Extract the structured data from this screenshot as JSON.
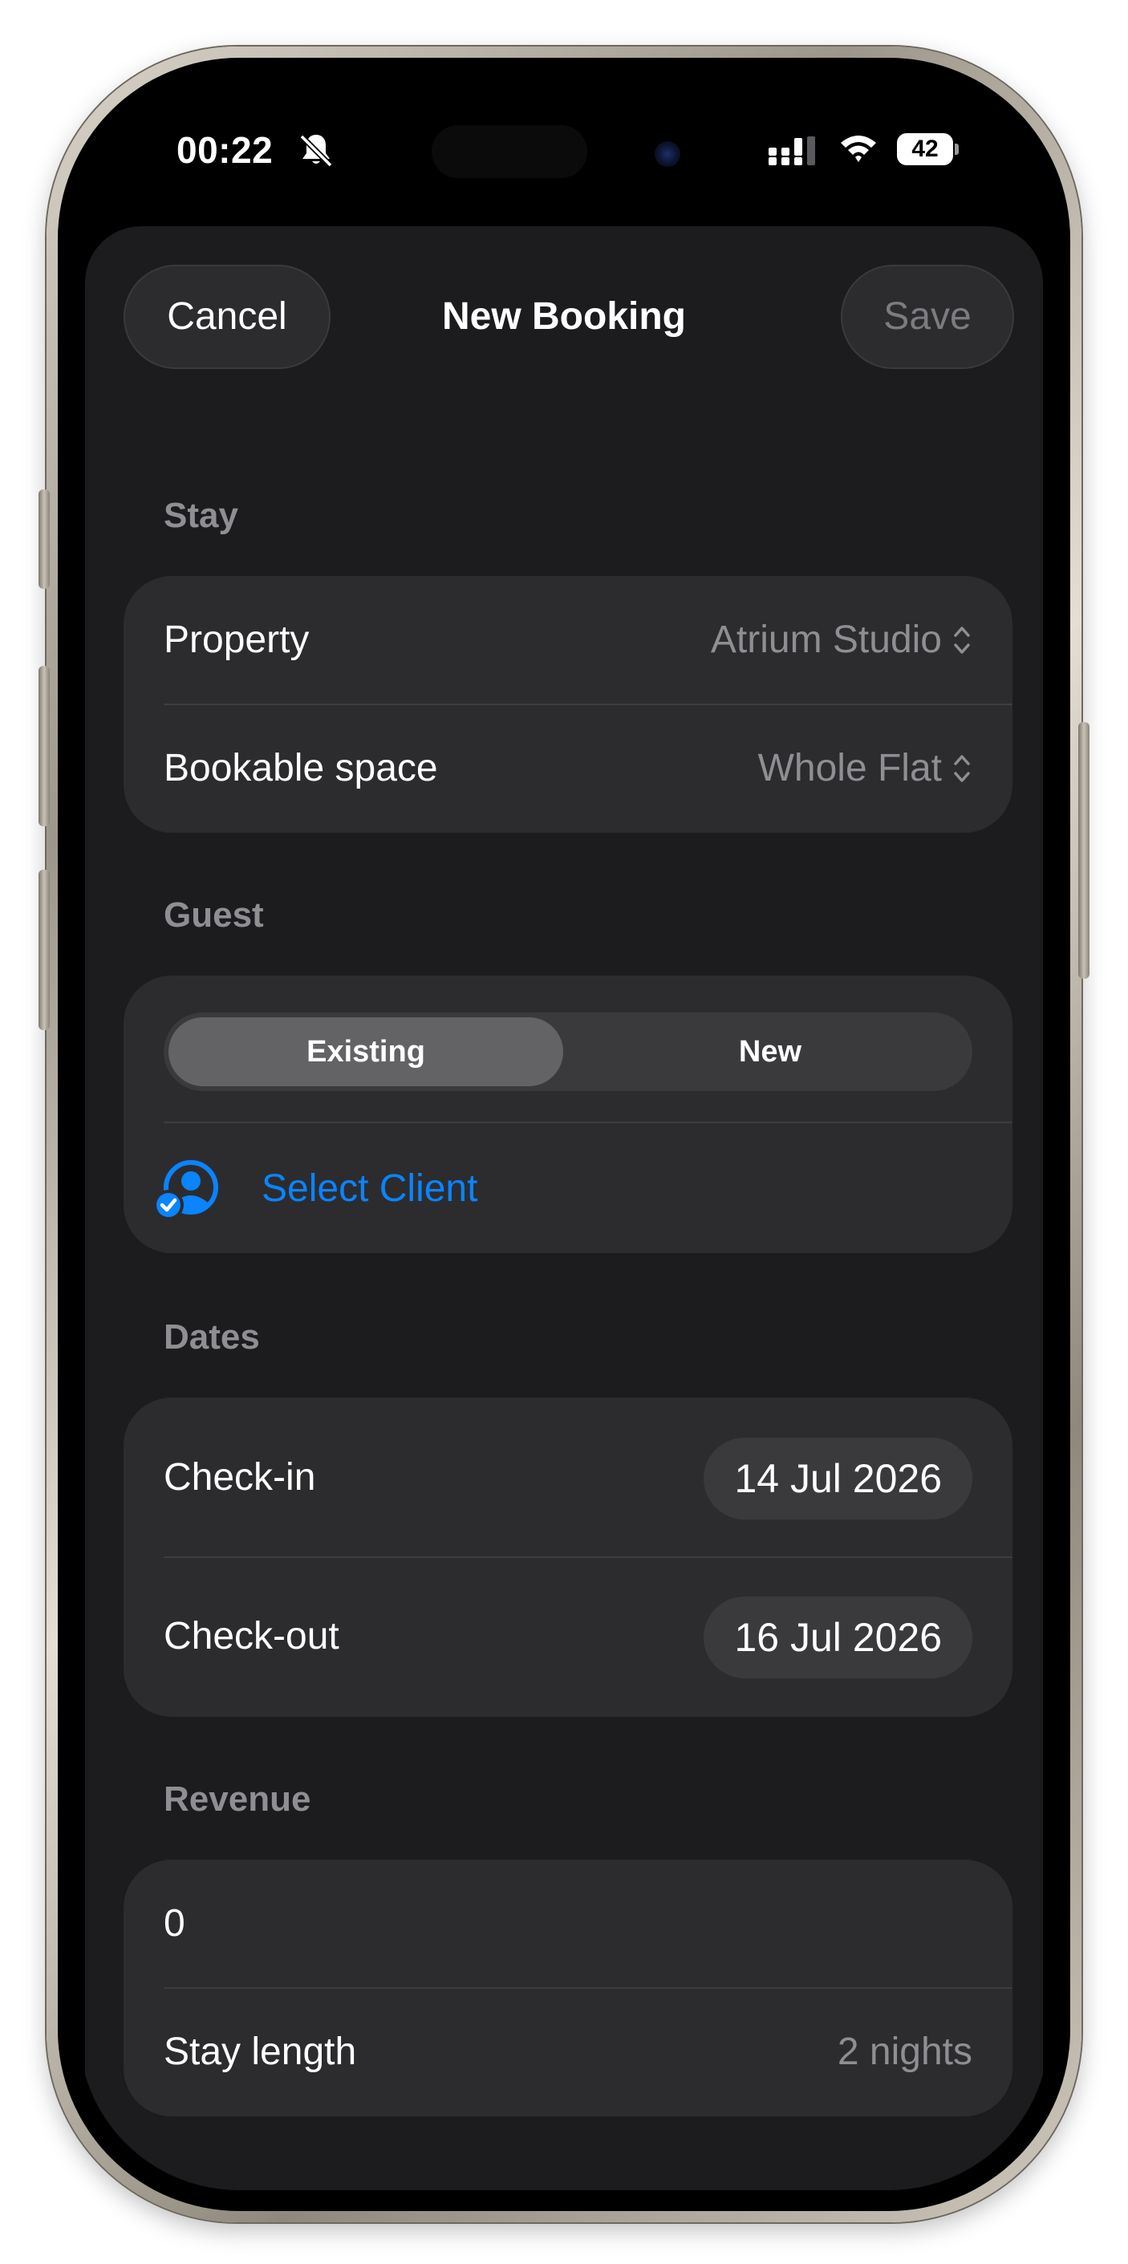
{
  "status_bar": {
    "time": "00:22",
    "battery": "42",
    "icons": [
      "bell-slash-icon",
      "signal-icon",
      "wifi-icon",
      "battery-icon"
    ]
  },
  "nav": {
    "cancel_label": "Cancel",
    "title": "New Booking",
    "save_label": "Save"
  },
  "stay": {
    "header": "Stay",
    "property_label": "Property",
    "property_value": "Atrium Studio",
    "space_label": "Bookable space",
    "space_value": "Whole Flat"
  },
  "guest": {
    "header": "Guest",
    "segments": [
      "Existing",
      "New"
    ],
    "selected_segment": "Existing",
    "select_client_label": "Select Client"
  },
  "dates": {
    "header": "Dates",
    "checkin_label": "Check-in",
    "checkin_value": "14 Jul 2026",
    "checkout_label": "Check-out",
    "checkout_value": "16 Jul 2026"
  },
  "revenue": {
    "header": "Revenue",
    "amount": "0",
    "stay_length_label": "Stay length",
    "stay_length_value": "2 nights"
  },
  "colors": {
    "accent": "#0a84ff",
    "background": "#1c1c1e",
    "card": "#2c2c2e",
    "secondary_text": "#8e8e93"
  }
}
